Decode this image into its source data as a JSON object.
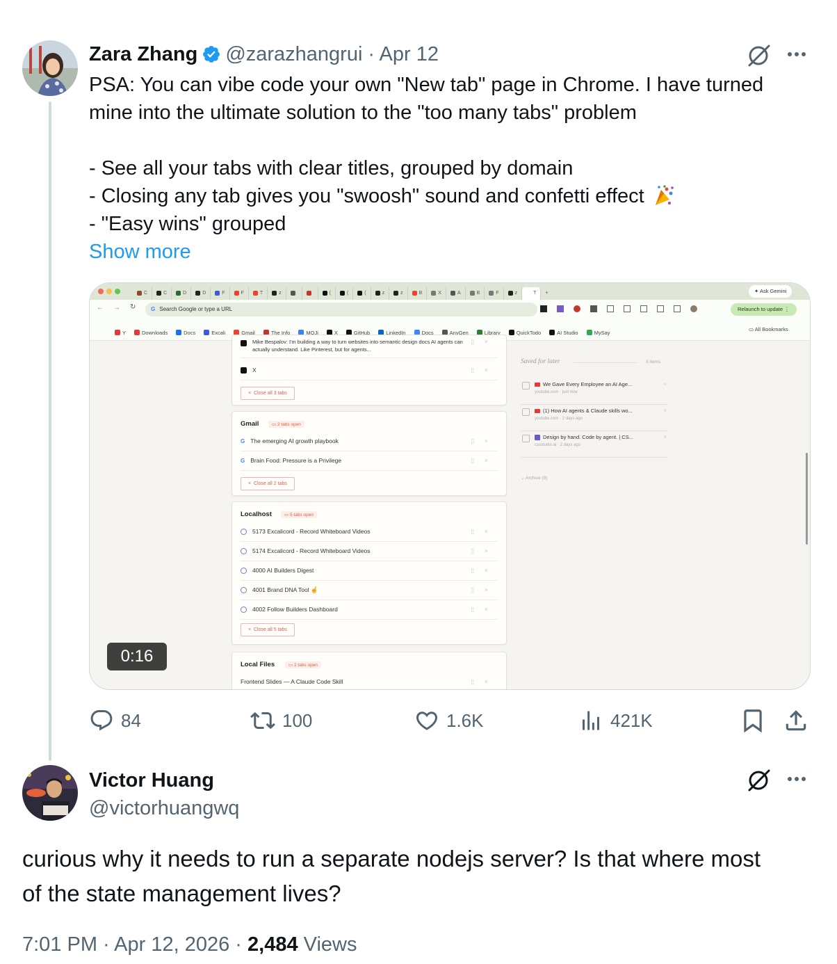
{
  "tweet": {
    "author_name": "Zara Zhang",
    "handle": "@zarazhangrui",
    "date": "· Apr 12",
    "lines": [
      "PSA: You can vibe code your own \"New tab\" page in Chrome. I have turned",
      "mine into the ultimate solution to the \"too many tabs\" problem",
      "- See all your tabs with clear titles, grouped by domain",
      "- Closing any tab gives you \"swoosh\" sound and confetti effect",
      "- \"Easy wins\" grouped"
    ],
    "emoji_name": "confetti-emoji",
    "show_more": "Show more",
    "video_time": "0:16",
    "actions": {
      "replies": "84",
      "reposts": "100",
      "likes": "1.6K",
      "views": "421K"
    }
  },
  "video": {
    "chrome_tabs": [
      "C",
      "C",
      "D",
      "D",
      "F",
      "F",
      "T",
      "z",
      "",
      "",
      "(",
      "(",
      "(",
      "z",
      "z",
      "B",
      "X",
      "A",
      "B",
      "F",
      "z",
      "T"
    ],
    "new_tab_plus": "+",
    "ask_gemini": "Ask Gemini",
    "address": "Search Google or type a URL",
    "relaunch": "Relaunch to update",
    "bookmarks": [
      "Y",
      "Downloads",
      "Docs",
      "Excali",
      "Gmail",
      "The Info",
      "MOJi",
      "X",
      "GitHub",
      "LinkedIn",
      "Docs",
      "AnyGen",
      "Library",
      "QuickTodo",
      "AI Studio",
      "MySay"
    ],
    "all_bookmarks": "All Bookmarks",
    "groups": [
      {
        "rows": [
          "Mike Bespalov: I'm building a way to turn websites into semantic design docs AI agents can actually understand. Like Pinterest, but for agents...",
          "X"
        ],
        "close": "Close all 3 tabs"
      },
      {
        "title": "Gmail",
        "badge": "2 tabs open",
        "rows": [
          "The emerging AI growth playbook",
          "Brain Food: Pressure is a Privilege"
        ],
        "close": "Close all 2 tabs"
      },
      {
        "title": "Localhost",
        "badge": "5 tabs open",
        "rows": [
          "5173 Excalicord - Record Whiteboard Videos",
          "5174 Excalicord - Record Whiteboard Videos",
          "4000 AI Builders Digest",
          "4001 Brand DNA Tool",
          "4002 Follow Builders Dashboard"
        ],
        "close": "Close all 5 tabs"
      },
      {
        "title": "Local Files",
        "badge": "2 tabs open",
        "rows": [
          "Frontend Slides — A Claude Code Skill"
        ]
      }
    ],
    "saved": {
      "title": "Saved for later",
      "count": "3 items",
      "items": [
        {
          "title": "We Gave Every Employee an AI Age...",
          "meta": "youtube.com · just now"
        },
        {
          "title": "(1) How AI agents & Claude skills wo...",
          "meta": "youtube.com · 2 days ago"
        },
        {
          "title": "Design by hand. Code by agent. | CS...",
          "meta": "cssstudio.ai · 2 days ago"
        }
      ],
      "archive": "Archive (8)"
    }
  },
  "reply": {
    "author_name": "Victor Huang",
    "handle": "@victorhuangwq",
    "text_lines": [
      "curious why it needs to run a separate nodejs server? Is that where most",
      "of the state management lives?"
    ],
    "time": "7:01 PM · Apr 12, 2026 · ",
    "views_count": "2,484",
    "views_label": " Views"
  },
  "colors": {
    "link": "#1d9bf0",
    "verified": "#1d9bf0",
    "secondary": "#536471",
    "thread_line": "#cfd9de"
  }
}
